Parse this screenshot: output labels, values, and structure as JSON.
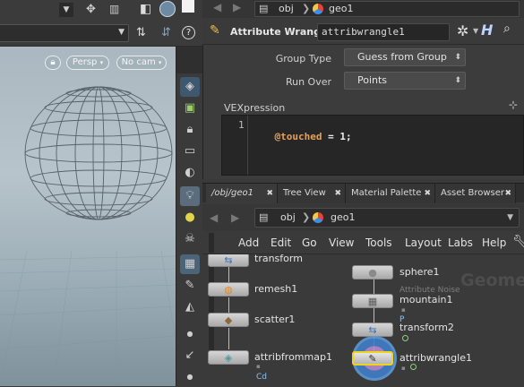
{
  "viewport": {
    "camera_mode": "Persp",
    "camera": "No cam"
  },
  "params": {
    "path": {
      "context": "obj",
      "node": "geo1"
    },
    "node_type": "Attribute Wrangle",
    "node_name": "attribwrangle1",
    "group_type_label": "Group Type",
    "group_type_value": "Guess from Group",
    "run_over_label": "Run Over",
    "run_over_value": "Points",
    "vex_label": "VEXpression",
    "code_line_number": "1",
    "code_attr": "@touched",
    "code_rest": " = 1;"
  },
  "tabs": [
    "/obj/geo1",
    "Tree View",
    "Material Palette",
    "Asset Browser"
  ],
  "network": {
    "path": {
      "context": "obj",
      "node": "geo1"
    },
    "menu": [
      "Add",
      "Edit",
      "Go",
      "View",
      "Tools",
      "Layout",
      "Labs",
      "Help"
    ],
    "watermark": "Geome",
    "nodes": [
      {
        "name": "transform"
      },
      {
        "name": "remesh1"
      },
      {
        "name": "scatter1"
      },
      {
        "name": "attribfrommap1",
        "flag": "Cd"
      },
      {
        "name": "sphere1"
      },
      {
        "name": "mountain1",
        "subtitle": "Attribute Noise",
        "flag": "P"
      },
      {
        "name": "transform2"
      },
      {
        "name": "attribwrangle1"
      }
    ]
  },
  "colors": {
    "selected_node_outline": "#f2d21b",
    "code_attr": "#e5a15a",
    "viewport_sky": "#b7c4cb"
  }
}
